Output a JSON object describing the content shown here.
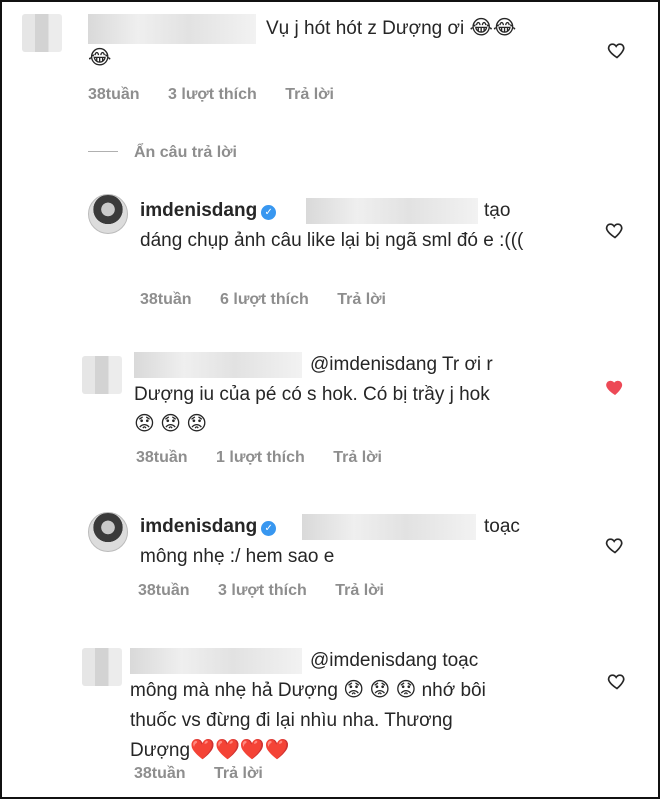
{
  "comments": [
    {
      "text": "Vụ j hót hót z Dượng ơi",
      "emojis": [
        "😂",
        "😂",
        "😂"
      ],
      "time": "38tuần",
      "likes": "3 lượt thích",
      "reply": "Trả lời",
      "liked": false
    },
    {
      "username": "imdenisdang",
      "text_after_mention": "tạo",
      "text": "dáng chụp ảnh câu like lại bị ngã sml đó e :(((",
      "time": "38tuần",
      "likes": "6 lượt thích",
      "reply": "Trả lời",
      "liked": false
    },
    {
      "mention": "@imdenisdang",
      "text_line1": "Tr ơi r",
      "text": "Dượng iu của pé có s hok. Có bị trầy j hok",
      "emojis": [
        "😟",
        "😟",
        "😟"
      ],
      "time": "38tuần",
      "likes": "1 lượt thích",
      "reply": "Trả lời",
      "liked": true
    },
    {
      "username": "imdenisdang",
      "text_after_mention": "toạc",
      "text": "mông nhẹ :/ hem sao e",
      "time": "38tuần",
      "likes": "3 lượt thích",
      "reply": "Trả lời",
      "liked": false
    },
    {
      "mention": "@imdenisdang",
      "text_line1": "toạc",
      "text_a": "mông mà nhẹ hả Dượng",
      "text_b": "nhớ bôi",
      "text_c": "thuốc vs đừng đi lại nhìu nha. Thương",
      "text_d": "Dượng",
      "emojis": [
        "😟",
        "😟",
        "😟"
      ],
      "hearts": [
        "❤️",
        "❤️",
        "❤️",
        "❤️"
      ],
      "time": "38tuần",
      "reply": "Trả lời",
      "liked": false
    }
  ],
  "hide_replies": "Ẩn câu trả lời",
  "colors": {
    "liked_heart": "#ed4956",
    "meta": "#8e8e8e",
    "verified": "#3897f0"
  }
}
